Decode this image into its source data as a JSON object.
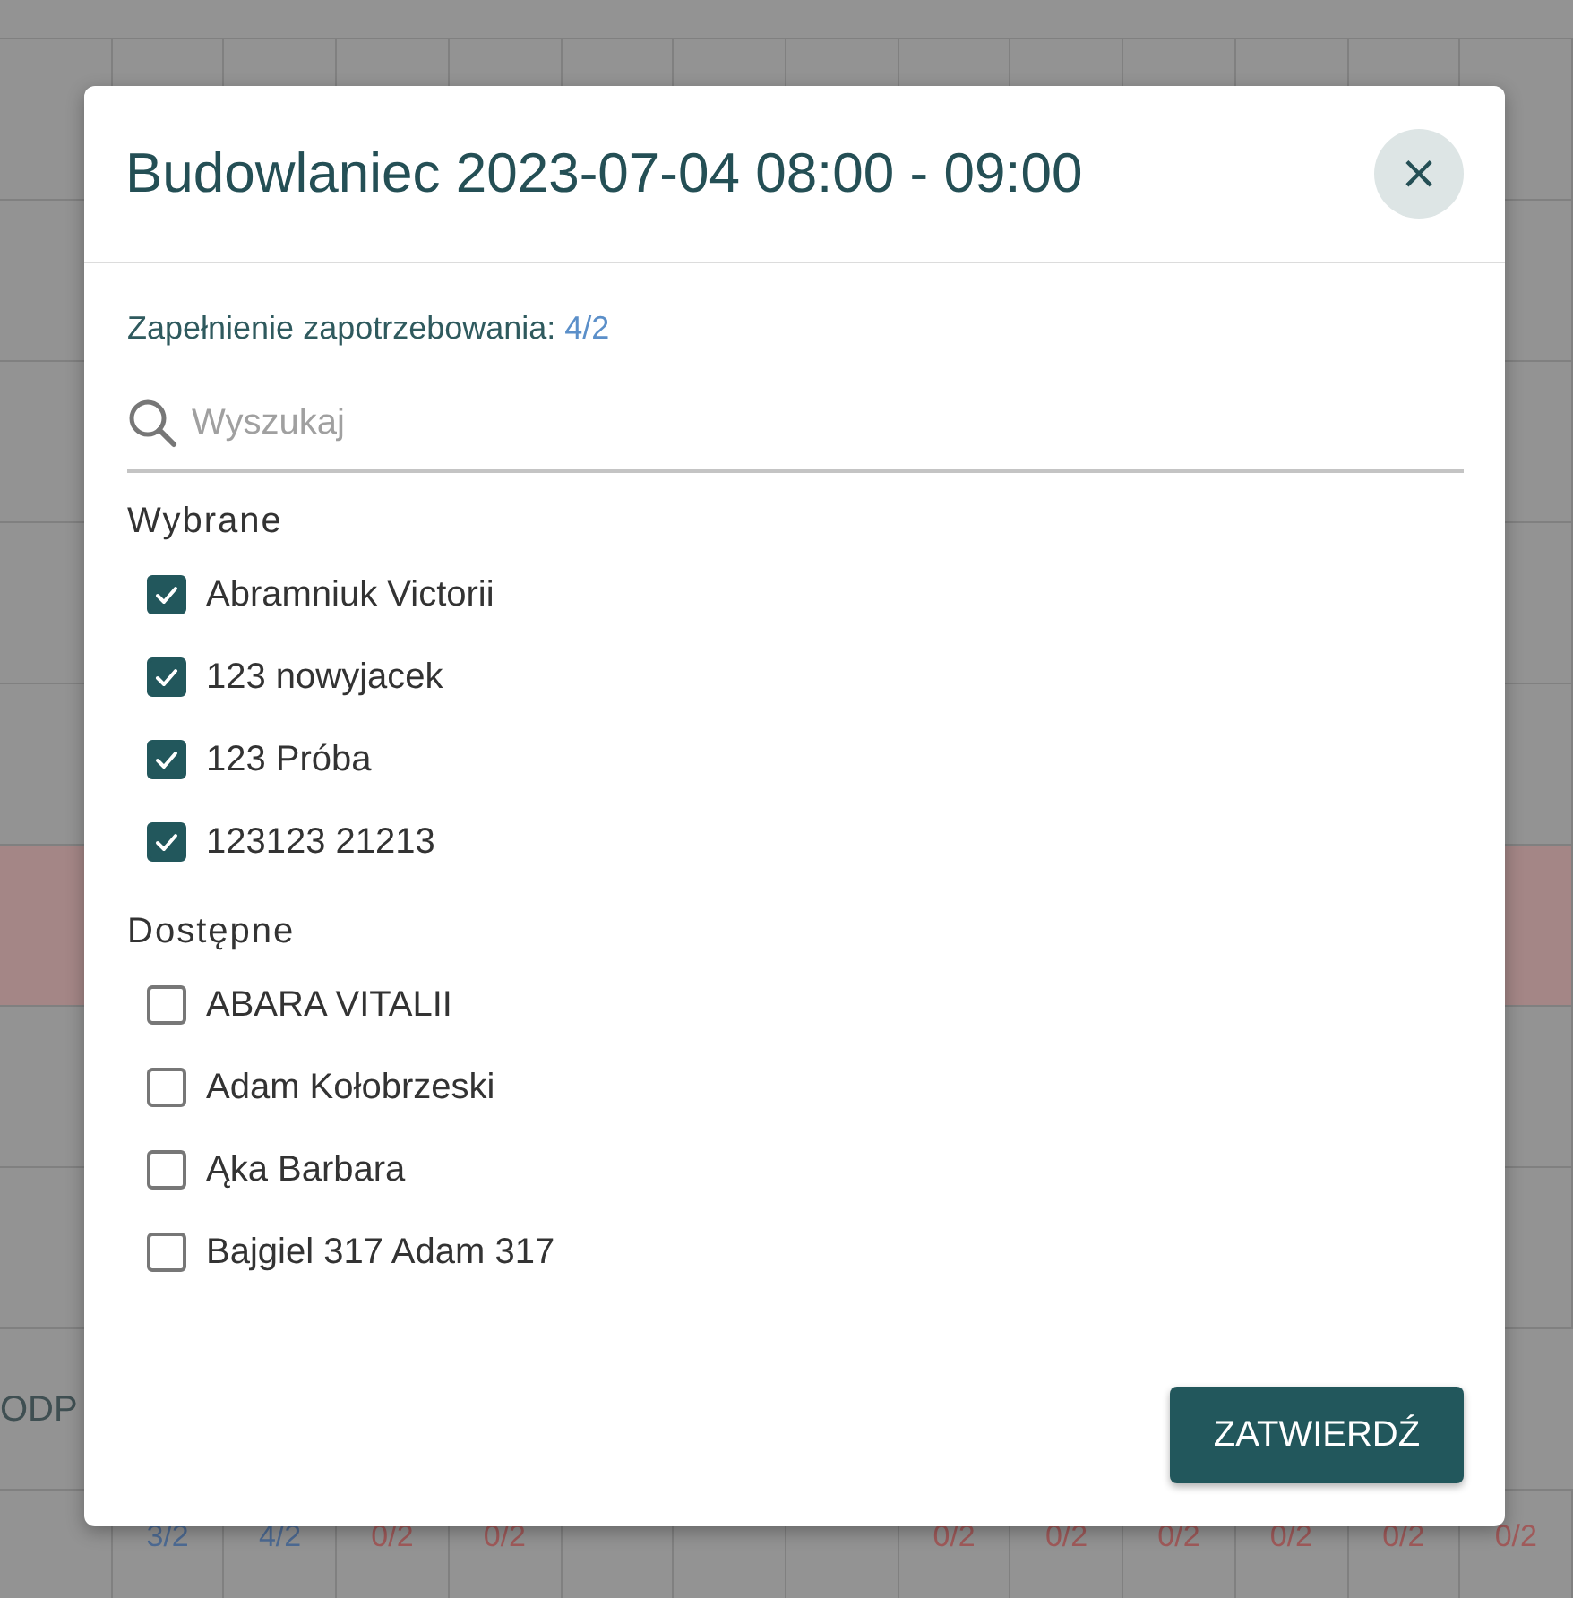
{
  "background": {
    "grid_rows": [
      {
        "highlighted": false
      },
      {
        "highlighted": false
      },
      {
        "highlighted": false
      },
      {
        "highlighted": false
      },
      {
        "highlighted": false
      },
      {
        "highlighted": true
      },
      {
        "highlighted": false
      },
      {
        "highlighted": false
      }
    ],
    "section_label": "ODP",
    "totals": [
      {
        "kind": "empty"
      },
      {
        "kind": "count",
        "text": "3/2",
        "color": "#4d6b94"
      },
      {
        "kind": "count",
        "text": "4/2",
        "color": "#4d6b94"
      },
      {
        "kind": "count",
        "text": "0/2",
        "color": "#a05a5a"
      },
      {
        "kind": "count",
        "text": "0/2",
        "color": "#a05a5a"
      },
      {
        "kind": "empty"
      },
      {
        "kind": "empty"
      },
      {
        "kind": "empty"
      },
      {
        "kind": "count",
        "text": "0/2",
        "color": "#a05a5a"
      },
      {
        "kind": "count",
        "text": "0/2",
        "color": "#a05a5a"
      },
      {
        "kind": "count",
        "text": "0/2",
        "color": "#a05a5a"
      },
      {
        "kind": "count",
        "text": "0/2",
        "color": "#a05a5a"
      },
      {
        "kind": "count",
        "text": "0/2",
        "color": "#a05a5a"
      },
      {
        "kind": "count",
        "text": "0/2",
        "color": "#a05a5a"
      }
    ]
  },
  "dialog": {
    "title": "Budowlaniec 2023-07-04 08:00 - 09:00",
    "close": "×",
    "fill_label": "Zapełnienie zapotrzebowania:",
    "fill_value": "4/2",
    "search": {
      "placeholder": "Wyszukaj"
    },
    "groups": [
      {
        "label": "Wybrane",
        "items": [
          {
            "name": "Abramniuk Victorii",
            "checked": true
          },
          {
            "name": "123 nowyjacek",
            "checked": true
          },
          {
            "name": "123 Próba",
            "checked": true
          },
          {
            "name": "123123 21213",
            "checked": true
          }
        ]
      },
      {
        "label": "Dostępne",
        "items": [
          {
            "name": "ABARA VITALII",
            "checked": false
          },
          {
            "name": "Adam Kołobrzeski",
            "checked": false
          },
          {
            "name": "Ąka Barbara",
            "checked": false
          },
          {
            "name": "Bajgiel 317 Adam 317",
            "checked": false
          }
        ]
      }
    ],
    "confirm": "ZATWIERDŹ"
  }
}
